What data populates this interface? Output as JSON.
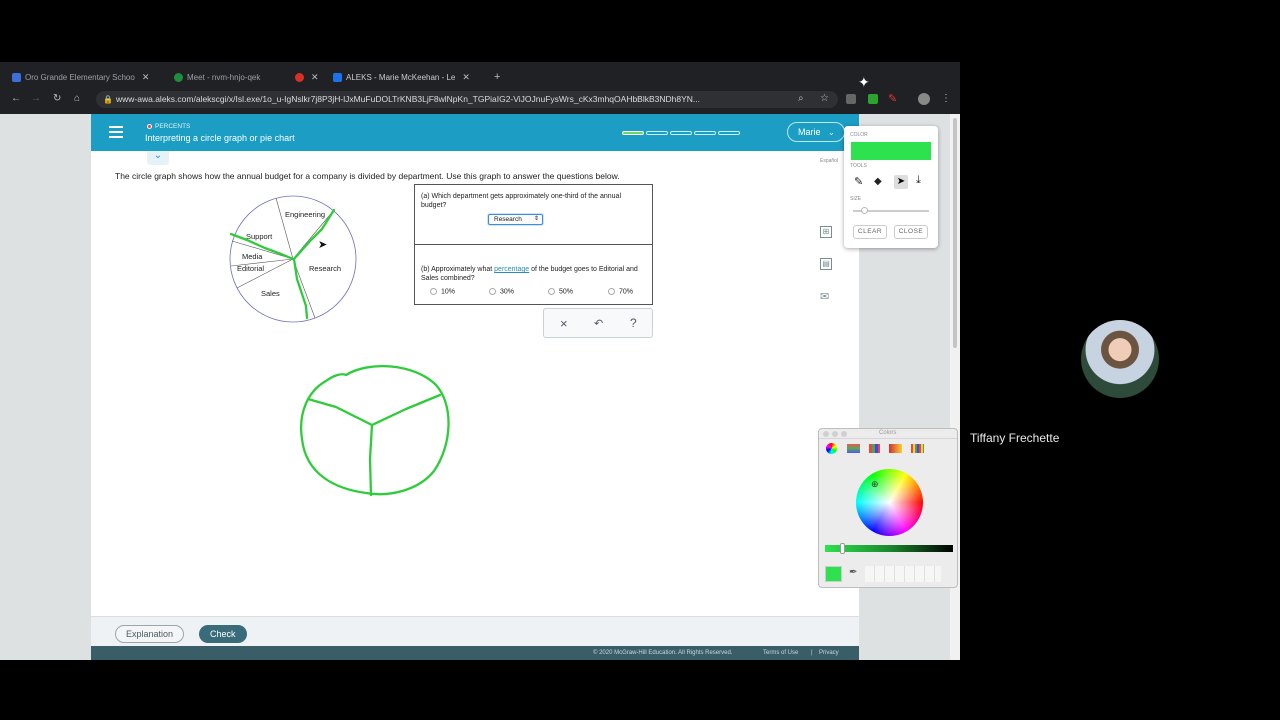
{
  "browser": {
    "tabs": [
      {
        "label": "Oro Grande Elementary Schoo",
        "color": "#3c6fd8"
      },
      {
        "label": "Meet - nvm-hnjo-qek",
        "color": "#1e8e3e"
      },
      {
        "label": "",
        "color": "#d93025"
      },
      {
        "label": "ALEKS - Marie McKeehan - Le",
        "color": "#1a73e8"
      }
    ],
    "url": "www-awa.aleks.com/alekscgi/x/Isl.exe/1o_u-IgNslkr7j8P3jH-lJxMuFuDOLTrKNB3LjF8wlNpKn_TGPiaIG2-ViJOJnuFysWrs_cKx3mhqOAHbBlkB3NDh8YN..."
  },
  "aleks": {
    "topic_category": "PERCENTS",
    "topic_title": "Interpreting a circle graph or pie chart",
    "user_menu": "Marie",
    "espanol": "Español",
    "prompt": "The circle graph shows how the annual budget for a company is divided by department.  Use this graph to answer the questions below.",
    "pie_labels": [
      "Engineering",
      "Support",
      "Media",
      "Editorial",
      "Sales",
      "Research"
    ],
    "question_a": "(a) Which department gets approximately one-third of the annual budget?",
    "answer_a": "Research",
    "question_b_pre": "(b) Approximately what ",
    "question_b_link": "percentage",
    "question_b_post": " of the budget goes to Editorial and Sales combined?",
    "options_b": [
      "10%",
      "30%",
      "50%",
      "70%"
    ],
    "action_clear_symbol": "×",
    "action_undo_symbol": "↶",
    "action_help_symbol": "?",
    "explanation_label": "Explanation",
    "check_label": "Check",
    "footer_copyright": "© 2020 McGraw-Hill Education. All Rights Reserved.",
    "footer_terms": "Terms of Use",
    "footer_privacy": "Privacy"
  },
  "draw_tool": {
    "color_label": "COLOR",
    "tools_label": "TOOLS",
    "size_label": "SIZE",
    "clear_label": "CLEAR",
    "close_label": "CLOSE",
    "selected_color": "#2ee24f"
  },
  "colors_window": {
    "title": "Colors",
    "selected_color": "#2ee24f"
  },
  "meet": {
    "participant_name": "Tiffany Frechette"
  }
}
